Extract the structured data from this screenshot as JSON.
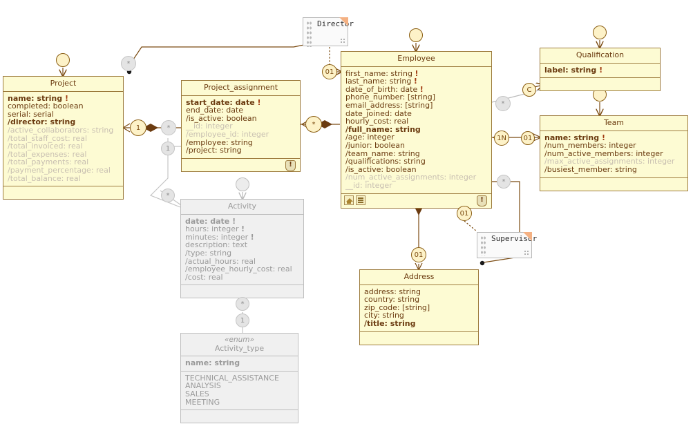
{
  "diagram": {
    "type": "UML class diagram",
    "classes": [
      {
        "id": "project",
        "name": "Project",
        "dim": false,
        "attributes": [
          {
            "text": "name: string",
            "style": "bold",
            "required": true
          },
          {
            "text": "completed: boolean",
            "style": "normal",
            "required": false
          },
          {
            "text": "serial: serial",
            "style": "normal",
            "required": false
          },
          {
            "text": "/director: string",
            "style": "bold",
            "required": false
          },
          {
            "text": "/active_collaborators: string",
            "style": "ghost",
            "required": false
          },
          {
            "text": "/total_staff_cost: real",
            "style": "ghost",
            "required": false
          },
          {
            "text": "/total_invoiced: real",
            "style": "ghost",
            "required": false
          },
          {
            "text": "/total_expenses: real",
            "style": "ghost",
            "required": false
          },
          {
            "text": "/total_payments: real",
            "style": "ghost",
            "required": false
          },
          {
            "text": "/payment_percentage: real",
            "style": "ghost",
            "required": false
          },
          {
            "text": "/total_balance: real",
            "style": "ghost",
            "required": false
          }
        ]
      },
      {
        "id": "project_assignment",
        "name": "Project_assignment",
        "dim": false,
        "attributes": [
          {
            "text": "start_date: date",
            "style": "bold",
            "required": true
          },
          {
            "text": "end_date: date",
            "style": "normal",
            "required": false
          },
          {
            "text": "/is_active: boolean",
            "style": "normal",
            "required": false
          },
          {
            "text": "__id: integer",
            "style": "ghost",
            "required": false
          },
          {
            "text": "/employee_id: integer",
            "style": "ghost",
            "required": false
          },
          {
            "text": "/employee: string",
            "style": "normal",
            "required": false
          },
          {
            "text": "/project: string",
            "style": "normal",
            "required": false
          }
        ]
      },
      {
        "id": "employee",
        "name": "Employee",
        "dim": false,
        "attributes": [
          {
            "text": "first_name: string",
            "style": "normal",
            "required": true
          },
          {
            "text": "last_name: string",
            "style": "normal",
            "required": true
          },
          {
            "text": "date_of_birth: date",
            "style": "normal",
            "required": true
          },
          {
            "text": "phone_number: [string]",
            "style": "normal",
            "required": false
          },
          {
            "text": "email_address: [string]",
            "style": "normal",
            "required": false
          },
          {
            "text": "date_joined: date",
            "style": "normal",
            "required": false
          },
          {
            "text": "hourly_cost: real",
            "style": "normal",
            "required": false
          },
          {
            "text": "/full_name: string",
            "style": "bold",
            "required": false
          },
          {
            "text": "/age: integer",
            "style": "normal",
            "required": false
          },
          {
            "text": "/junior: boolean",
            "style": "normal",
            "required": false
          },
          {
            "text": "/team_name: string",
            "style": "normal",
            "required": false
          },
          {
            "text": "/qualifications: string",
            "style": "normal",
            "required": false
          },
          {
            "text": "/is_active: boolean",
            "style": "normal",
            "required": false
          },
          {
            "text": "/num_active_assignments: integer",
            "style": "ghost",
            "required": false
          },
          {
            "text": "__id: integer",
            "style": "ghost",
            "required": false
          }
        ]
      },
      {
        "id": "qualification",
        "name": "Qualification",
        "dim": false,
        "attributes": [
          {
            "text": "label: string",
            "style": "bold",
            "required": true
          }
        ]
      },
      {
        "id": "team",
        "name": "Team",
        "dim": false,
        "attributes": [
          {
            "text": "name: string",
            "style": "bold",
            "required": true
          },
          {
            "text": "/num_members: integer",
            "style": "normal",
            "required": false
          },
          {
            "text": "/num_active_members: integer",
            "style": "normal",
            "required": false
          },
          {
            "text": "/max_active_assignments: integer",
            "style": "ghost",
            "required": false
          },
          {
            "text": "/busiest_member: string",
            "style": "normal",
            "required": false
          }
        ]
      },
      {
        "id": "activity",
        "name": "Activity",
        "dim": true,
        "attributes": [
          {
            "text": "date: date",
            "style": "bold",
            "required": true
          },
          {
            "text": "hours: integer",
            "style": "normal",
            "required": true
          },
          {
            "text": "minutes: integer",
            "style": "normal",
            "required": true
          },
          {
            "text": "description: text",
            "style": "normal",
            "required": false
          },
          {
            "text": "/type: string",
            "style": "normal",
            "required": false
          },
          {
            "text": "/actual_hours: real",
            "style": "normal",
            "required": false
          },
          {
            "text": "/employee_hourly_cost: real",
            "style": "normal",
            "required": false
          },
          {
            "text": "/cost: real",
            "style": "normal",
            "required": false
          }
        ]
      },
      {
        "id": "activity_type",
        "name": "Activity_type",
        "stereotype": "«enum»",
        "dim": true,
        "attributes": [
          {
            "text": "name: string",
            "style": "bold",
            "required": false
          }
        ],
        "literals": [
          "TECHNICAL_ASSISTANCE",
          "ANALYSIS",
          "SALES",
          "MEETING"
        ]
      },
      {
        "id": "address",
        "name": "Address",
        "dim": false,
        "attributes": [
          {
            "text": "address: string",
            "style": "normal",
            "required": false
          },
          {
            "text": "country: string",
            "style": "normal",
            "required": false
          },
          {
            "text": "zip_code: [string]",
            "style": "normal",
            "required": false
          },
          {
            "text": "city: string",
            "style": "normal",
            "required": false
          },
          {
            "text": "/title: string",
            "style": "bold",
            "required": false
          }
        ]
      }
    ],
    "notes": [
      {
        "id": "director_note",
        "label": "Director"
      },
      {
        "id": "supervisor_note",
        "label": "Supervisor"
      }
    ],
    "multiplicity_badges": [
      {
        "id": "badge-project-top-star",
        "label": "*",
        "tone": "gray"
      },
      {
        "id": "badge-project-assignment-one",
        "label": "1",
        "tone": "brown"
      },
      {
        "id": "badge-assignment-star-left",
        "label": "*",
        "tone": "gray"
      },
      {
        "id": "badge-assignment-activity-one",
        "label": "1",
        "tone": "gray"
      },
      {
        "id": "badge-activity-star",
        "label": "*",
        "tone": "gray"
      },
      {
        "id": "badge-employee-assignment-star",
        "label": "*",
        "tone": "brown"
      },
      {
        "id": "badge-director-01",
        "label": "01",
        "tone": "brown"
      },
      {
        "id": "badge-employee-qualification-star",
        "label": "*",
        "tone": "gray"
      },
      {
        "id": "badge-qualification-c",
        "label": "C",
        "tone": "brown"
      },
      {
        "id": "badge-employee-team-1n",
        "label": "1N",
        "tone": "brown"
      },
      {
        "id": "badge-team-01",
        "label": "01",
        "tone": "brown"
      },
      {
        "id": "badge-employee-supervisor-star",
        "label": "*",
        "tone": "gray"
      },
      {
        "id": "badge-supervisor-01",
        "label": "01",
        "tone": "brown"
      },
      {
        "id": "badge-address-01",
        "label": "01",
        "tone": "brown"
      },
      {
        "id": "badge-activity-type-star",
        "label": "*",
        "tone": "gray"
      },
      {
        "id": "badge-activity-type-one",
        "label": "1",
        "tone": "gray"
      }
    ],
    "colors": {
      "class_fill": "#fdfbd3",
      "class_border": "#9c7a3c",
      "class_text": "#6b3b10",
      "dim_fill": "#f0f0f0",
      "dim_border": "#bdbdbd",
      "dim_text": "#9a9a9a",
      "edge": "#7a4a10",
      "edge_dim": "#b9b9b9",
      "required_marker": "#a13c12",
      "note_corner": "#f4b183"
    }
  }
}
